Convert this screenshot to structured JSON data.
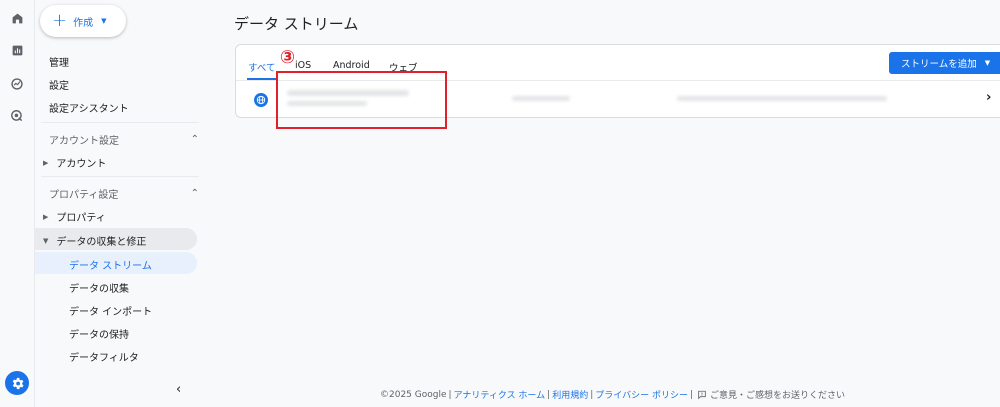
{
  "sidebar": {
    "create_label": "作成",
    "items": {
      "admin": "管理",
      "settings": "設定",
      "setup_assistant": "設定アシスタント"
    },
    "account_section": {
      "title": "アカウント設定",
      "account": "アカウント"
    },
    "property_section": {
      "title": "プロパティ設定",
      "property": "プロパティ",
      "data_collection_modification": "データの収集と修正",
      "sub_items": {
        "data_streams": "データ ストリーム",
        "data_collection": "データの収集",
        "data_import": "データ インポート",
        "data_retention": "データの保持",
        "data_filters": "データフィルタ"
      }
    },
    "collapse_glyph": "‹"
  },
  "main": {
    "title": "データ ストリーム",
    "tabs": [
      "すべて",
      "iOS",
      "Android",
      "ウェブ"
    ],
    "active_tab": 0,
    "add_stream_button": "ストリームを追加",
    "row_chevron": "›"
  },
  "annotation": {
    "number": "③",
    "color": "#e0202a"
  },
  "footer": {
    "copyright": "©2025 Google",
    "analytics_home": "アナリティクス ホーム",
    "terms": "利用規約",
    "privacy": "プライバシー ポリシー",
    "feedback": "ご意見・ご感想をお送りください",
    "separator": "|"
  },
  "colors": {
    "accent": "#1a73e8",
    "annotation": "#e0202a"
  },
  "icons": {
    "rail": [
      "home-icon",
      "reports-icon",
      "explore-icon",
      "advertising-icon",
      "admin-gear-icon"
    ],
    "row": "globe-icon",
    "footer": "feedback-icon"
  }
}
